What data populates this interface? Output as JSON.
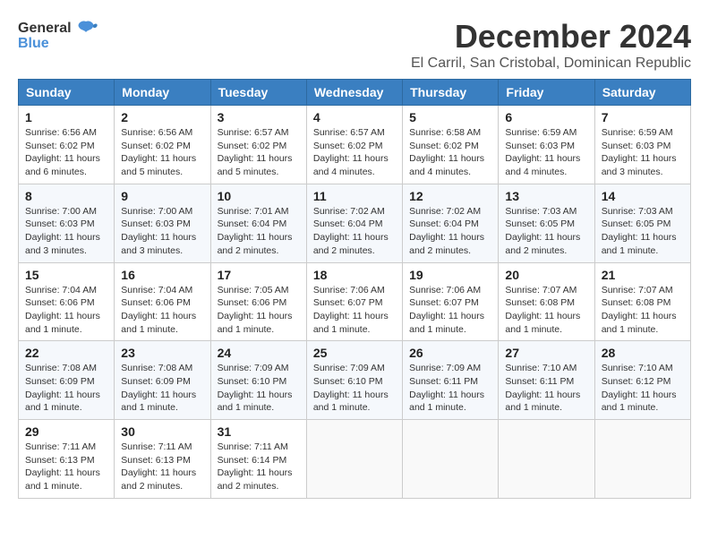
{
  "logo": {
    "general": "General",
    "blue": "Blue"
  },
  "title": "December 2024",
  "location": "El Carril, San Cristobal, Dominican Republic",
  "days_of_week": [
    "Sunday",
    "Monday",
    "Tuesday",
    "Wednesday",
    "Thursday",
    "Friday",
    "Saturday"
  ],
  "weeks": [
    [
      {
        "day": "1",
        "sunrise": "6:56 AM",
        "sunset": "6:02 PM",
        "daylight": "11 hours and 6 minutes."
      },
      {
        "day": "2",
        "sunrise": "6:56 AM",
        "sunset": "6:02 PM",
        "daylight": "11 hours and 5 minutes."
      },
      {
        "day": "3",
        "sunrise": "6:57 AM",
        "sunset": "6:02 PM",
        "daylight": "11 hours and 5 minutes."
      },
      {
        "day": "4",
        "sunrise": "6:57 AM",
        "sunset": "6:02 PM",
        "daylight": "11 hours and 4 minutes."
      },
      {
        "day": "5",
        "sunrise": "6:58 AM",
        "sunset": "6:02 PM",
        "daylight": "11 hours and 4 minutes."
      },
      {
        "day": "6",
        "sunrise": "6:59 AM",
        "sunset": "6:03 PM",
        "daylight": "11 hours and 4 minutes."
      },
      {
        "day": "7",
        "sunrise": "6:59 AM",
        "sunset": "6:03 PM",
        "daylight": "11 hours and 3 minutes."
      }
    ],
    [
      {
        "day": "8",
        "sunrise": "7:00 AM",
        "sunset": "6:03 PM",
        "daylight": "11 hours and 3 minutes."
      },
      {
        "day": "9",
        "sunrise": "7:00 AM",
        "sunset": "6:03 PM",
        "daylight": "11 hours and 3 minutes."
      },
      {
        "day": "10",
        "sunrise": "7:01 AM",
        "sunset": "6:04 PM",
        "daylight": "11 hours and 2 minutes."
      },
      {
        "day": "11",
        "sunrise": "7:02 AM",
        "sunset": "6:04 PM",
        "daylight": "11 hours and 2 minutes."
      },
      {
        "day": "12",
        "sunrise": "7:02 AM",
        "sunset": "6:04 PM",
        "daylight": "11 hours and 2 minutes."
      },
      {
        "day": "13",
        "sunrise": "7:03 AM",
        "sunset": "6:05 PM",
        "daylight": "11 hours and 2 minutes."
      },
      {
        "day": "14",
        "sunrise": "7:03 AM",
        "sunset": "6:05 PM",
        "daylight": "11 hours and 1 minute."
      }
    ],
    [
      {
        "day": "15",
        "sunrise": "7:04 AM",
        "sunset": "6:06 PM",
        "daylight": "11 hours and 1 minute."
      },
      {
        "day": "16",
        "sunrise": "7:04 AM",
        "sunset": "6:06 PM",
        "daylight": "11 hours and 1 minute."
      },
      {
        "day": "17",
        "sunrise": "7:05 AM",
        "sunset": "6:06 PM",
        "daylight": "11 hours and 1 minute."
      },
      {
        "day": "18",
        "sunrise": "7:06 AM",
        "sunset": "6:07 PM",
        "daylight": "11 hours and 1 minute."
      },
      {
        "day": "19",
        "sunrise": "7:06 AM",
        "sunset": "6:07 PM",
        "daylight": "11 hours and 1 minute."
      },
      {
        "day": "20",
        "sunrise": "7:07 AM",
        "sunset": "6:08 PM",
        "daylight": "11 hours and 1 minute."
      },
      {
        "day": "21",
        "sunrise": "7:07 AM",
        "sunset": "6:08 PM",
        "daylight": "11 hours and 1 minute."
      }
    ],
    [
      {
        "day": "22",
        "sunrise": "7:08 AM",
        "sunset": "6:09 PM",
        "daylight": "11 hours and 1 minute."
      },
      {
        "day": "23",
        "sunrise": "7:08 AM",
        "sunset": "6:09 PM",
        "daylight": "11 hours and 1 minute."
      },
      {
        "day": "24",
        "sunrise": "7:09 AM",
        "sunset": "6:10 PM",
        "daylight": "11 hours and 1 minute."
      },
      {
        "day": "25",
        "sunrise": "7:09 AM",
        "sunset": "6:10 PM",
        "daylight": "11 hours and 1 minute."
      },
      {
        "day": "26",
        "sunrise": "7:09 AM",
        "sunset": "6:11 PM",
        "daylight": "11 hours and 1 minute."
      },
      {
        "day": "27",
        "sunrise": "7:10 AM",
        "sunset": "6:11 PM",
        "daylight": "11 hours and 1 minute."
      },
      {
        "day": "28",
        "sunrise": "7:10 AM",
        "sunset": "6:12 PM",
        "daylight": "11 hours and 1 minute."
      }
    ],
    [
      {
        "day": "29",
        "sunrise": "7:11 AM",
        "sunset": "6:13 PM",
        "daylight": "11 hours and 1 minute."
      },
      {
        "day": "30",
        "sunrise": "7:11 AM",
        "sunset": "6:13 PM",
        "daylight": "11 hours and 2 minutes."
      },
      {
        "day": "31",
        "sunrise": "7:11 AM",
        "sunset": "6:14 PM",
        "daylight": "11 hours and 2 minutes."
      },
      null,
      null,
      null,
      null
    ]
  ],
  "labels": {
    "sunrise": "Sunrise:",
    "sunset": "Sunset:",
    "daylight": "Daylight:"
  }
}
